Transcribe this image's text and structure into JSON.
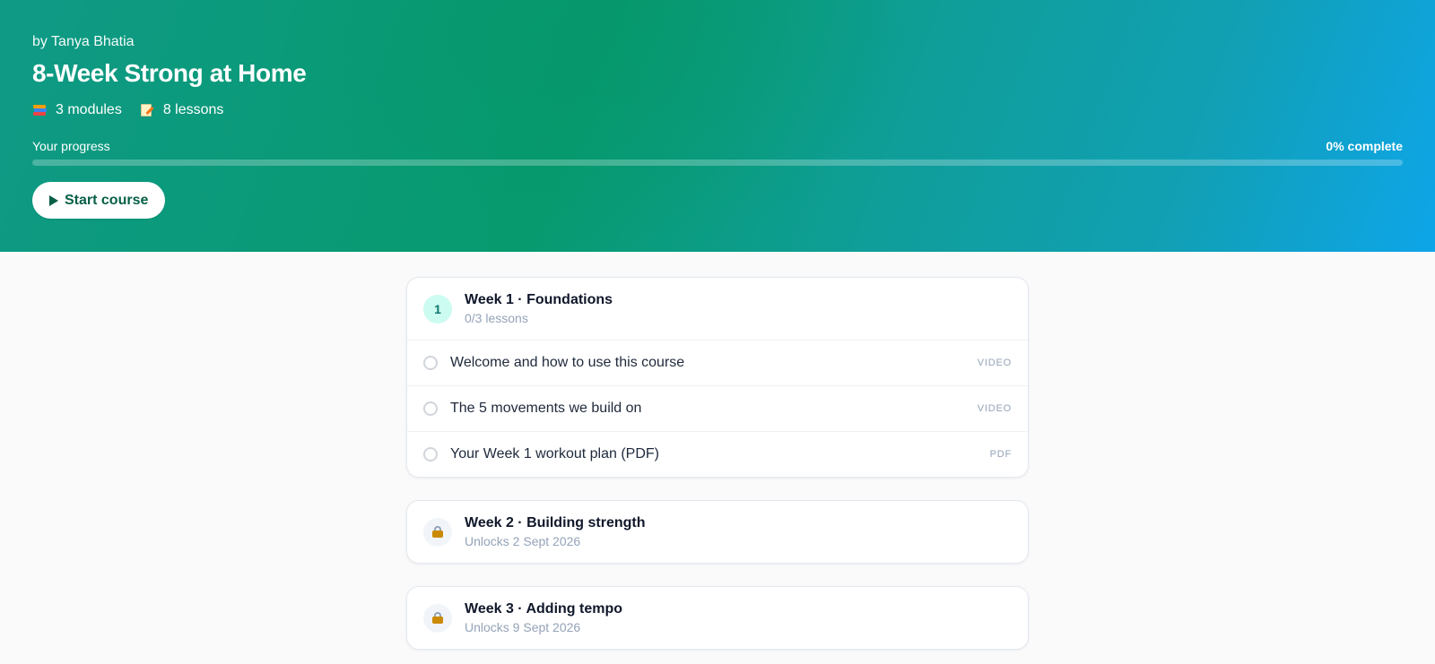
{
  "hero": {
    "author": "by Tanya Bhatia",
    "title": "8-Week Strong at Home",
    "modules_count": "3 modules",
    "lessons_count": "8 lessons",
    "modules_icon": "books-icon",
    "lessons_icon": "memo-icon",
    "progress_label": "Your progress",
    "progress_text": "0% complete",
    "progress_fraction": 0,
    "start_label": "Start course"
  },
  "colors": {
    "brand_teal": "#0f766e",
    "brand_green": "#059669",
    "brand_blue": "#0ea5e9"
  },
  "modules": [
    {
      "badge": "1",
      "title": "Week 1 · Foundations",
      "subtitle": "0/3 lessons",
      "locked": false,
      "lessons": [
        {
          "title": "Welcome and how to use this course",
          "type": "VIDEO",
          "completed": false
        },
        {
          "title": "The 5 movements we build on",
          "type": "VIDEO",
          "completed": false
        },
        {
          "title": "Your Week 1 workout plan (PDF)",
          "type": "PDF",
          "completed": false
        }
      ]
    },
    {
      "title": "Week 2 · Building strength",
      "subtitle": "Unlocks 2 Sept 2026",
      "locked": true,
      "icon": "lock-icon"
    },
    {
      "title": "Week 3 · Adding tempo",
      "subtitle": "Unlocks 9 Sept 2026",
      "locked": true,
      "icon": "lock-icon"
    }
  ]
}
